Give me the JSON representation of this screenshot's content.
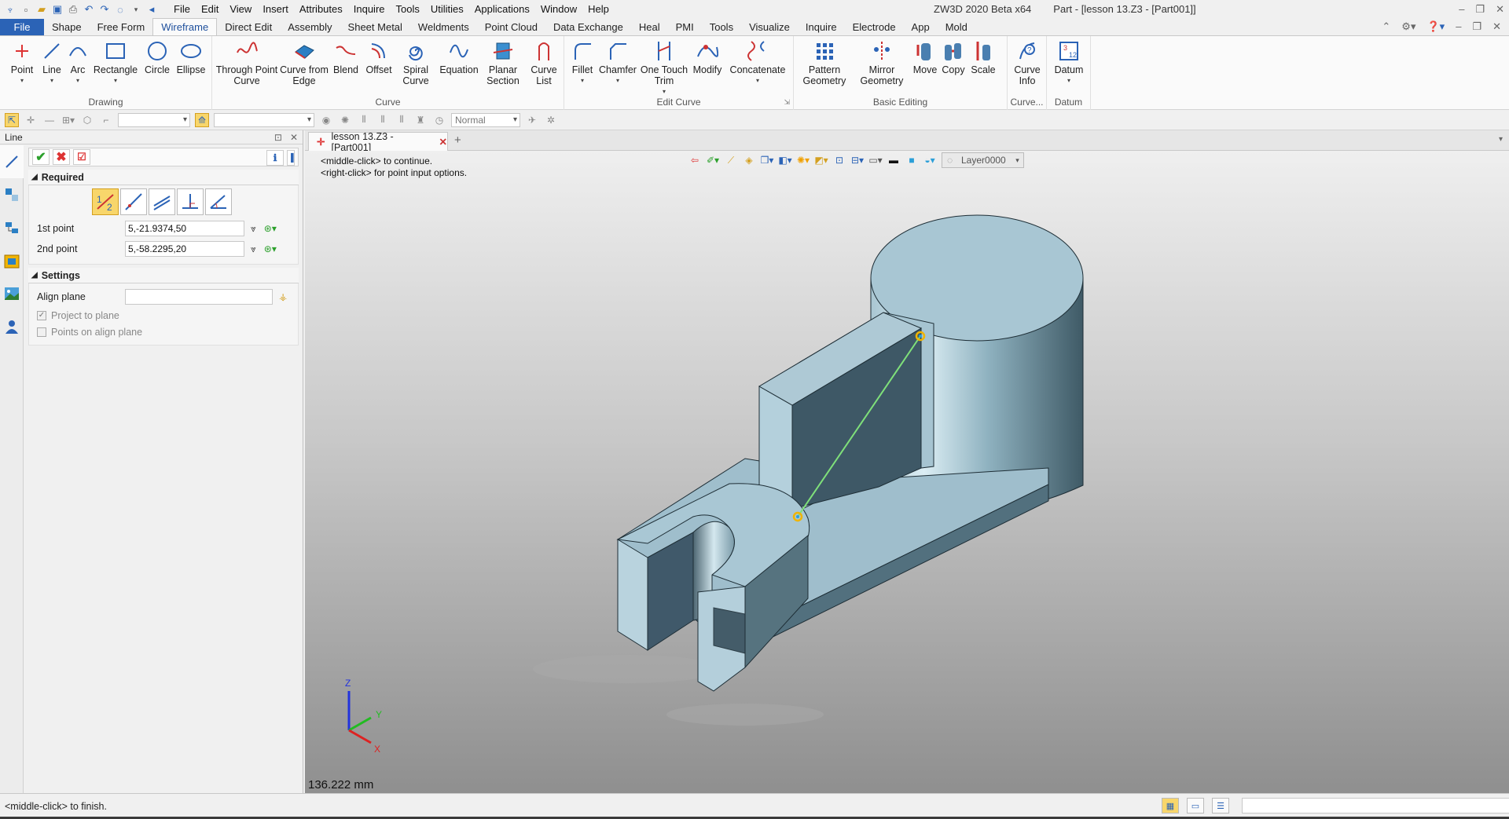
{
  "app": {
    "window_title": "ZW3D 2020 Beta x64",
    "doc_title": "Part - [lesson 13.Z3 - [Part001]]"
  },
  "quick_access": [
    "new-file-icon",
    "open-folder-icon",
    "save-icon",
    "print-icon",
    "undo-icon",
    "redo-icon",
    "select-icon",
    "dropdown-icon",
    "back-arrow-icon"
  ],
  "menu": [
    "File",
    "Edit",
    "View",
    "Insert",
    "Attributes",
    "Inquire",
    "Tools",
    "Utilities",
    "Applications",
    "Window",
    "Help"
  ],
  "ribbon_tabs": [
    "File",
    "Shape",
    "Free Form",
    "Wireframe",
    "Direct Edit",
    "Assembly",
    "Sheet Metal",
    "Weldments",
    "Point Cloud",
    "Data Exchange",
    "Heal",
    "PMI",
    "Tools",
    "Visualize",
    "Inquire",
    "Electrode",
    "App",
    "Mold"
  ],
  "active_tab": "Wireframe",
  "ribbon": {
    "drawing": {
      "label": "Drawing",
      "buttons": [
        "Point",
        "Line",
        "Arc",
        "Rectangle",
        "Circle",
        "Ellipse"
      ]
    },
    "curve": {
      "label": "Curve",
      "buttons": [
        "Through Point Curve",
        "Curve from Edge",
        "Blend",
        "Offset",
        "Spiral Curve",
        "Equation",
        "Planar Section",
        "Curve List"
      ]
    },
    "edit_curve": {
      "label": "Edit Curve",
      "buttons": [
        "Fillet",
        "Chamfer",
        "One Touch Trim",
        "Modify",
        "Concatenate"
      ]
    },
    "basic_editing": {
      "label": "Basic Editing",
      "buttons": [
        "Pattern Geometry",
        "Mirror Geometry",
        "Move",
        "Copy",
        "Scale"
      ]
    },
    "curve_info": {
      "label": "Curve...",
      "buttons": [
        "Curve Info"
      ]
    },
    "datum": {
      "label": "Datum",
      "buttons": [
        "Datum"
      ]
    }
  },
  "toolbar2": {
    "filter_value": "",
    "layer_filter_value": "",
    "render_mode": "Normal"
  },
  "panel": {
    "title": "Line",
    "required_label": "Required",
    "first_point_label": "1st point",
    "first_point_value": "5,-21.9374,50",
    "second_point_label": "2nd point",
    "second_point_value": "5,-58.2295,20",
    "settings_label": "Settings",
    "align_plane_label": "Align plane",
    "align_plane_value": "",
    "project_to_plane_label": "Project to plane",
    "project_to_plane_checked": true,
    "points_on_align_plane_label": "Points on align plane",
    "points_on_align_plane_checked": false
  },
  "document_tab": "lesson 13.Z3 - [Part001]",
  "viewport": {
    "hint_line1": "<middle-click> to continue.",
    "hint_line2": "<right-click> for point input options.",
    "layer": "Layer0000",
    "distance_readout": "136.222 mm",
    "axis_x": "X",
    "axis_y": "Y",
    "axis_z": "Z"
  },
  "status": {
    "text": "<middle-click> to finish."
  },
  "colors": {
    "accent": "#2b63b6",
    "model_face": "#a8c4d0",
    "preview_line": "#7fe07a",
    "selection": "#f0b400"
  }
}
